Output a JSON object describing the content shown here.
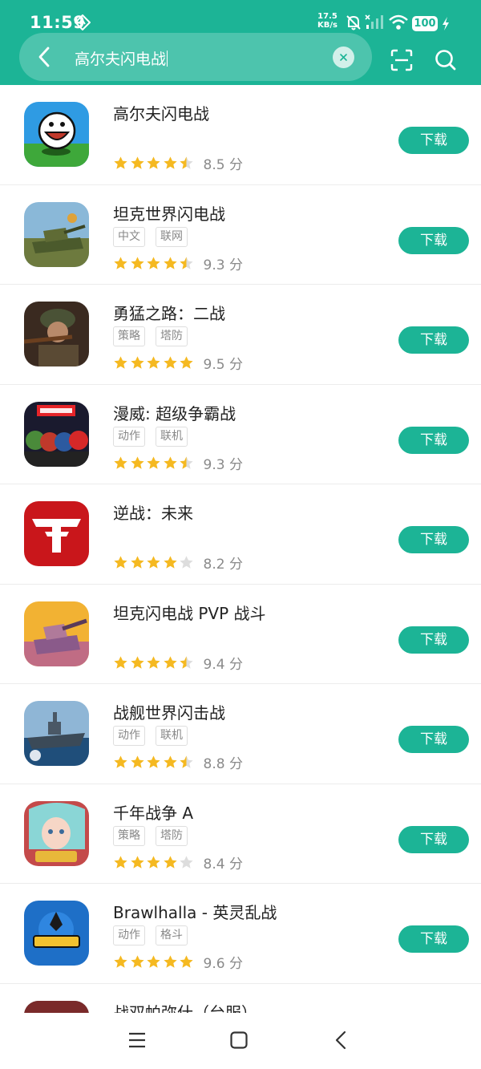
{
  "status_bar": {
    "time": "11:59",
    "speed_value": "17.5",
    "speed_unit": "KB/s",
    "battery": "100",
    "icons": [
      "location-icon",
      "mute-icon",
      "signal-icon",
      "wifi-icon",
      "battery-icon",
      "charging-icon"
    ]
  },
  "search": {
    "query": "高尔夫闪电战"
  },
  "colors": {
    "accent": "#1cb496",
    "star": "#f5b921",
    "star_empty": "#dddddd"
  },
  "apps": [
    {
      "name": "高尔夫闪电战",
      "tags": [],
      "rating": 4.5,
      "score": "8.5 分",
      "download": "下载",
      "icon": "golf-ball-icon"
    },
    {
      "name": "坦克世界闪电战",
      "tags": [
        "中文",
        "联网"
      ],
      "rating": 4.5,
      "score": "9.3 分",
      "download": "下载",
      "icon": "tank-icon"
    },
    {
      "name": "勇猛之路：二战",
      "tags": [
        "策略",
        "塔防"
      ],
      "rating": 5,
      "score": "9.5 分",
      "download": "下载",
      "icon": "soldier-icon"
    },
    {
      "name": "漫威: 超级争霸战",
      "tags": [
        "动作",
        "联机"
      ],
      "rating": 4.5,
      "score": "9.3 分",
      "download": "下载",
      "icon": "marvel-heroes-icon"
    },
    {
      "name": "逆战：未来",
      "tags": [],
      "rating": 4,
      "score": "8.2 分",
      "download": "下载",
      "icon": "red-logo-icon"
    },
    {
      "name": "坦克闪电战 PVP 战斗",
      "tags": [],
      "rating": 4.5,
      "score": "9.4 分",
      "download": "下载",
      "icon": "cartoon-tank-icon"
    },
    {
      "name": "战舰世界闪击战",
      "tags": [
        "动作",
        "联机"
      ],
      "rating": 4.5,
      "score": "8.8 分",
      "download": "下载",
      "icon": "battleship-icon"
    },
    {
      "name": "千年战争 A",
      "tags": [
        "策略",
        "塔防"
      ],
      "rating": 4,
      "score": "8.4 分",
      "download": "下载",
      "icon": "anime-girl-icon"
    },
    {
      "name": "Brawlhalla - 英灵乱战",
      "tags": [
        "动作",
        "格斗"
      ],
      "rating": 5,
      "score": "9.6 分",
      "download": "下载",
      "icon": "brawlhalla-icon"
    },
    {
      "name": "战双帕弥什（台服）",
      "tags": [],
      "rating": 0,
      "score": "",
      "download": "",
      "icon": "anime-character-icon"
    }
  ]
}
